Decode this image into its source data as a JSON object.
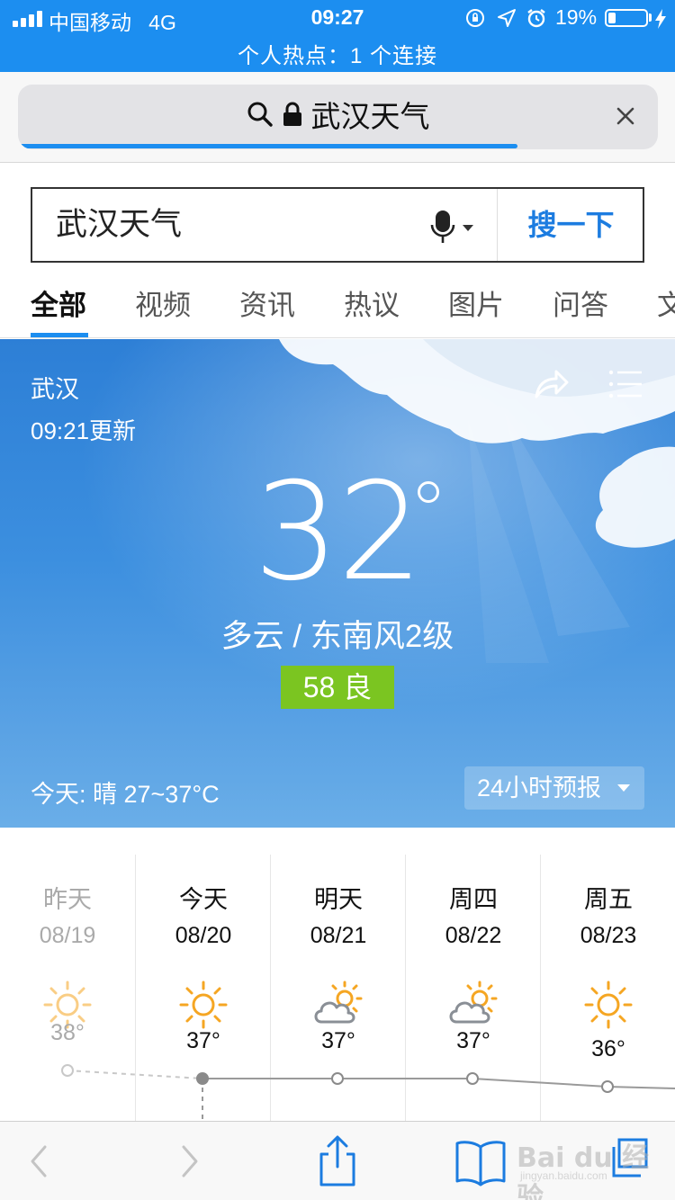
{
  "status_bar": {
    "carrier": "中国移动",
    "network": "4G",
    "time": "09:27",
    "battery": "19%",
    "battery_level": 0.19,
    "hotspot": "个人热点：1 个连接",
    "icons": [
      "signal-icon",
      "orientation-lock-icon",
      "location-icon",
      "alarm-icon",
      "battery-icon",
      "charging-icon"
    ]
  },
  "url_bar": {
    "text": "武汉天气",
    "icons": [
      "search-icon",
      "lock-icon",
      "close-icon"
    ],
    "load_progress": 0.78
  },
  "search": {
    "query": "武汉天气",
    "button": "搜一下",
    "icons": [
      "microphone-icon",
      "chevron-down-icon"
    ]
  },
  "tabs": [
    {
      "label": "全部",
      "active": true
    },
    {
      "label": "视频",
      "active": false
    },
    {
      "label": "资讯",
      "active": false
    },
    {
      "label": "热议",
      "active": false
    },
    {
      "label": "图片",
      "active": false
    },
    {
      "label": "问答",
      "active": false
    },
    {
      "label": "文",
      "active": false
    }
  ],
  "weather": {
    "city": "武汉",
    "updated": "09:21更新",
    "temperature": "32",
    "condition": "多云  /  东南风2级",
    "aqi": "58 良",
    "aqi_color": "#7bc521",
    "today_summary": "今天:  晴   27~37°C",
    "forecast_button": "24小时预报",
    "icons": [
      "share-icon",
      "menu-icon"
    ]
  },
  "forecast": [
    {
      "day": "昨天",
      "date": "08/19",
      "icon": "sun-icon",
      "high": "38°",
      "high_value": 38,
      "past": true
    },
    {
      "day": "今天",
      "date": "08/20",
      "icon": "sun-icon",
      "high": "37°",
      "high_value": 37,
      "past": false
    },
    {
      "day": "明天",
      "date": "08/21",
      "icon": "partly-cloudy-icon",
      "high": "37°",
      "high_value": 37,
      "past": false
    },
    {
      "day": "周四",
      "date": "08/22",
      "icon": "partly-cloudy-icon",
      "high": "37°",
      "high_value": 37,
      "past": false
    },
    {
      "day": "周五",
      "date": "08/23",
      "icon": "sun-icon",
      "high": "36°",
      "high_value": 36,
      "past": false
    }
  ],
  "toolbar": {
    "icons": [
      "back-icon",
      "forward-icon",
      "share-icon",
      "bookmarks-icon",
      "tabs-icon"
    ]
  },
  "watermark": {
    "text": "Bai du 经验",
    "sub": "jingyan.baidu.com"
  },
  "colors": {
    "accent": "#1c8ef0",
    "search_button_text": "#1c7ce0",
    "sun": "#f5a623"
  }
}
